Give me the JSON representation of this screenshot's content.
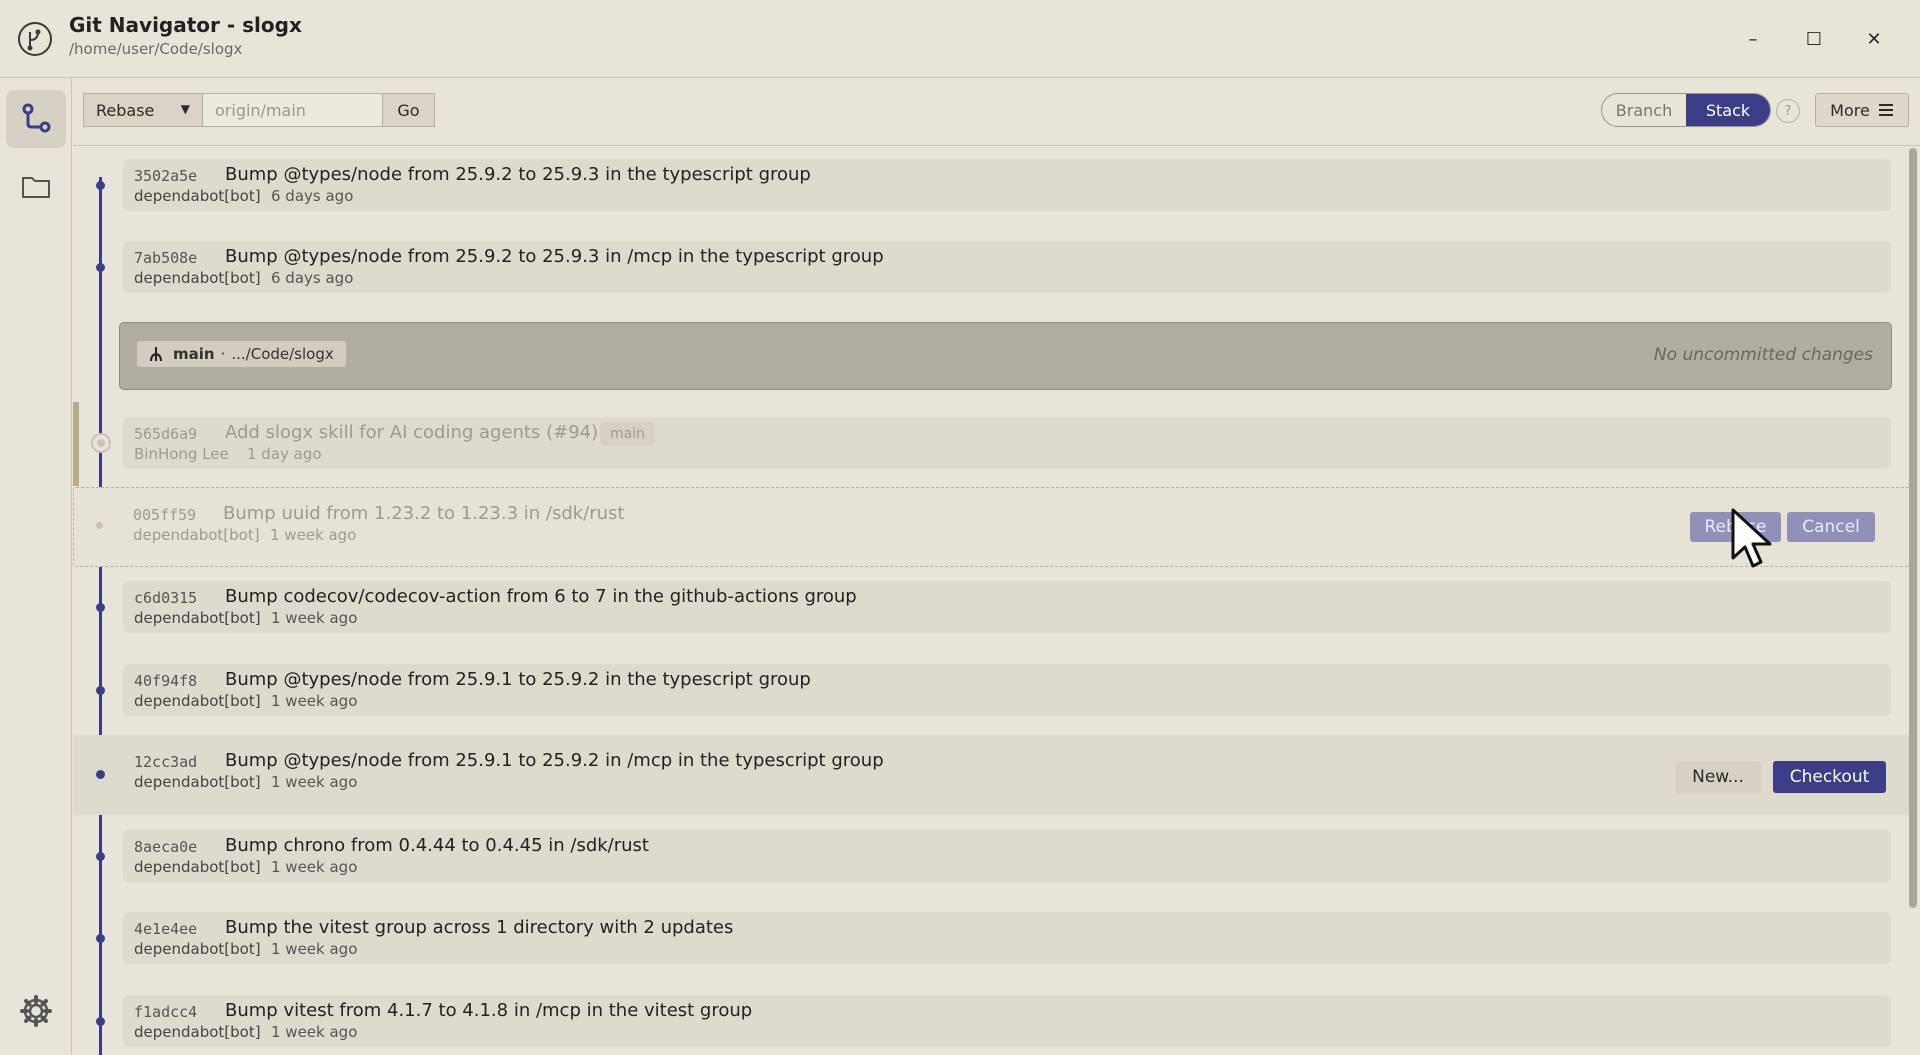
{
  "window": {
    "title": "Git Navigator - slogx",
    "path": "/home/user/Code/slogx",
    "minimize": "–",
    "maximize": "☐",
    "close": "✕"
  },
  "toolbar": {
    "mode": "Rebase",
    "target_placeholder": "origin/main",
    "go_label": "Go",
    "view_branch": "Branch",
    "view_stack": "Stack",
    "help_label": "?",
    "more_label": "More"
  },
  "worktree": {
    "branch": "main",
    "separator": "·",
    "path": ".../Code/slogx",
    "status": "No uncommitted changes"
  },
  "commits": [
    {
      "hash": "3502a5e",
      "message": "Bump @types/node from 25.9.2 to 25.9.3 in the typescript group",
      "author": "dependabot[bot]",
      "ago": "6 days ago"
    },
    {
      "hash": "7ab508e",
      "message": "Bump @types/node from 25.9.2 to 25.9.3 in /mcp in the typescript group",
      "author": "dependabot[bot]",
      "ago": "6 days ago"
    },
    {
      "hash": "565d6a9",
      "message": "Add slogx skill for AI coding agents (#94)",
      "author": "BinHong Lee",
      "ago": "1 day ago",
      "tag": "main"
    },
    {
      "hash": "005ff59",
      "message": "Bump uuid from 1.23.2 to 1.23.3 in /sdk/rust",
      "author": "dependabot[bot]",
      "ago": "1 week ago"
    },
    {
      "hash": "c6d0315",
      "message": "Bump codecov/codecov-action from 6 to 7 in the github-actions group",
      "author": "dependabot[bot]",
      "ago": "1 week ago"
    },
    {
      "hash": "40f94f8",
      "message": "Bump @types/node from 25.9.1 to 25.9.2 in the typescript group",
      "author": "dependabot[bot]",
      "ago": "1 week ago"
    },
    {
      "hash": "12cc3ad",
      "message": "Bump @types/node from 25.9.1 to 25.9.2 in /mcp in the typescript group",
      "author": "dependabot[bot]",
      "ago": "1 week ago"
    },
    {
      "hash": "8aeca0e",
      "message": "Bump chrono from 0.4.44 to 0.4.45 in /sdk/rust",
      "author": "dependabot[bot]",
      "ago": "1 week ago"
    },
    {
      "hash": "4e1e4ee",
      "message": "Bump the vitest group across 1 directory with 2 updates",
      "author": "dependabot[bot]",
      "ago": "1 week ago"
    },
    {
      "hash": "f1adcc4",
      "message": "Bump vitest from 4.1.7 to 4.1.8 in /mcp in the vitest group",
      "author": "dependabot[bot]",
      "ago": "1 week ago"
    }
  ],
  "drag_actions": {
    "rebase": "Rebase",
    "cancel": "Cancel"
  },
  "row_actions": {
    "new": "New...",
    "checkout": "Checkout"
  },
  "colors": {
    "accent": "#3b3e87",
    "background": "#e8e4d8",
    "row": "#dedace"
  }
}
